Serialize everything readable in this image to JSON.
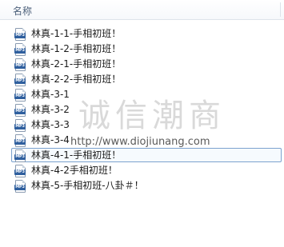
{
  "header": {
    "name_column": "名称"
  },
  "files": [
    {
      "name": "林真-1-1-手相初班！",
      "icon": "mp3-file-icon",
      "icon_label": "MP3"
    },
    {
      "name": "林真-1-2-手相初班！",
      "icon": "mp3-file-icon",
      "icon_label": "MP3"
    },
    {
      "name": "林真-2-1-手相初班！",
      "icon": "mp3-file-icon",
      "icon_label": "MP3"
    },
    {
      "name": "林真-2-2-手相初班！",
      "icon": "mp3-file-icon",
      "icon_label": "MP3"
    },
    {
      "name": "林真-3-1",
      "icon": "mp3-file-icon",
      "icon_label": "MP3"
    },
    {
      "name": "林真-3-2",
      "icon": "mp3-file-icon",
      "icon_label": "MP3"
    },
    {
      "name": "林真-3-3",
      "icon": "mp3-file-icon",
      "icon_label": "MP3"
    },
    {
      "name": "林真-3-4",
      "icon": "mp3-file-icon",
      "icon_label": "MP3"
    },
    {
      "name": "林真-4-1-手相初班！",
      "icon": "mp3-file-icon",
      "icon_label": "MP3"
    },
    {
      "name": "林真-4-2手相初班！",
      "icon": "mp3-file-icon",
      "icon_label": "MP3"
    },
    {
      "name": "林真-5-手相初班-八卦＃！",
      "icon": "mp3-file-icon",
      "icon_label": "MP3"
    }
  ],
  "selected_index": 8,
  "watermark": {
    "logo": "诚信潮商",
    "url": "http://www.diojiunang.com"
  },
  "colors": {
    "selection_border": "#7da2ce",
    "header_text": "#4c607a",
    "icon_band": "#2f5f9e"
  }
}
